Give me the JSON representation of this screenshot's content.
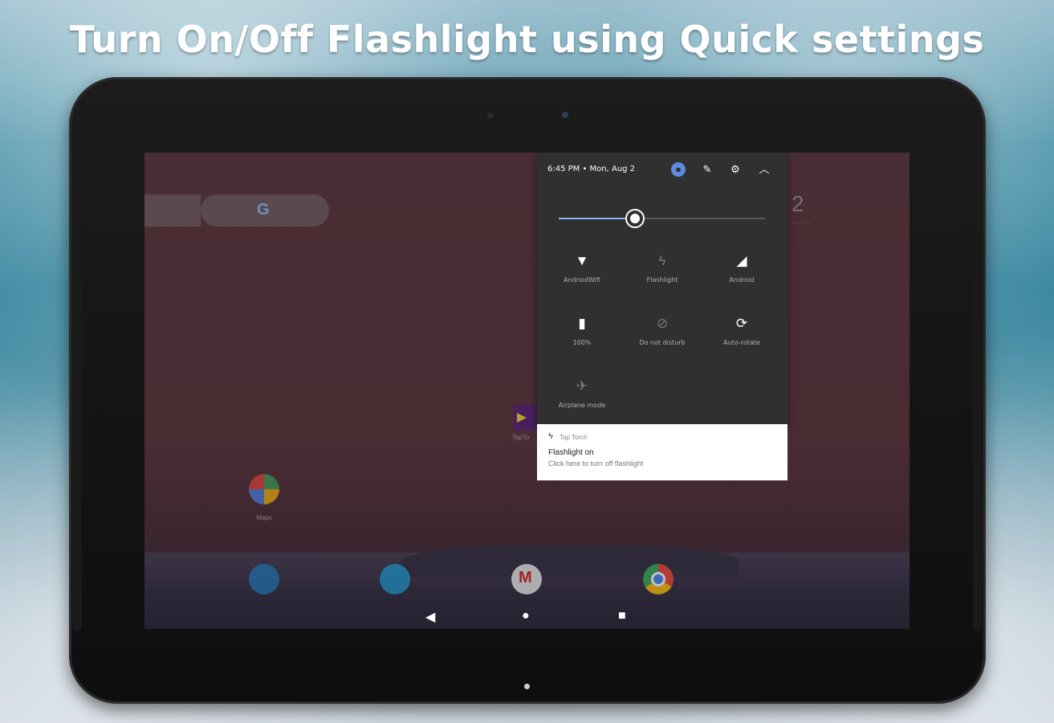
{
  "banner": {
    "title": "Turn On/Off Flashlight using Quick settings"
  },
  "home_screen": {
    "search_logo": "G",
    "clock_fragment": "2",
    "app_maps_label": "Maps",
    "widget_label": "TapTo",
    "dock_icons": [
      "phone-icon",
      "messages-icon",
      "gmail-icon",
      "chrome-icon"
    ]
  },
  "quick_settings": {
    "time_date": "6:45 PM • Mon, Aug 2",
    "header_icons": [
      "user-icon",
      "edit-icon",
      "settings-icon",
      "collapse-icon"
    ],
    "brightness_level": 0.37,
    "tiles": [
      {
        "label": "AndroidWifi",
        "icon": "wifi-icon",
        "active": true
      },
      {
        "label": "Flashlight",
        "icon": "flashlight-icon",
        "active": false
      },
      {
        "label": "Android",
        "icon": "cellular-icon",
        "active": true
      },
      {
        "label": "100%",
        "icon": "battery-icon",
        "active": true
      },
      {
        "label": "Do not disturb",
        "icon": "do-not-disturb-icon",
        "active": false
      },
      {
        "label": "Auto-rotate",
        "icon": "auto-rotate-icon",
        "active": true
      },
      {
        "label": "Airplane mode",
        "icon": "airplane-icon",
        "active": false
      }
    ]
  },
  "notification": {
    "app_name": "Tap Torch",
    "title": "Flashlight on",
    "text": "Click here to turn off flashlight"
  },
  "nav": {
    "back": "◀",
    "home": "●",
    "recents": "■"
  }
}
